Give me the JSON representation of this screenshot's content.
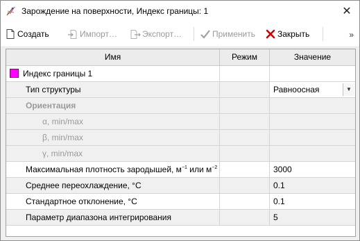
{
  "window": {
    "title": "Зарождение на поверхности, Индекс границы: 1",
    "close_glyph": "✕"
  },
  "toolbar": {
    "create_label": "Создать",
    "import_label": "Импорт…",
    "export_label": "Экспорт…",
    "apply_label": "Применить",
    "close_label": "Закрыть",
    "more_glyph": "»"
  },
  "table": {
    "headers": {
      "name": "Имя",
      "mode": "Режим",
      "value": "Значение"
    },
    "rows": [
      {
        "name": "Индекс границы 1",
        "mode": "",
        "value": ""
      },
      {
        "name": "Тип структуры",
        "mode": "",
        "value": "Равноосная"
      },
      {
        "name": "Ориентация",
        "mode": "",
        "value": ""
      },
      {
        "name": "α, min/max",
        "mode": "",
        "value": ""
      },
      {
        "name": "β, min/max",
        "mode": "",
        "value": ""
      },
      {
        "name": "γ, min/max",
        "mode": "",
        "value": ""
      },
      {
        "name": "Максимальная плотность зародышей, м",
        "sup1": "−1",
        "name_mid": " или м",
        "sup2": "−2",
        "mode": "",
        "value": "3000"
      },
      {
        "name": "Среднее переохлаждение, °C",
        "mode": "",
        "value": "0.1"
      },
      {
        "name": "Стандартное отклонение, °C",
        "mode": "",
        "value": "0.1"
      },
      {
        "name": "Параметр диапазона интегрирования",
        "mode": "",
        "value": "5"
      }
    ]
  },
  "colors": {
    "boundary_swatch": "#ff00ff",
    "close_icon_red": "#cc0000",
    "apply_check_gray": "#a0a0a0"
  },
  "icons": {
    "title": "nucleation-icon",
    "create": "new-document-icon",
    "import": "import-icon",
    "export": "export-icon",
    "apply": "checkmark-icon",
    "close": "red-x-icon"
  }
}
